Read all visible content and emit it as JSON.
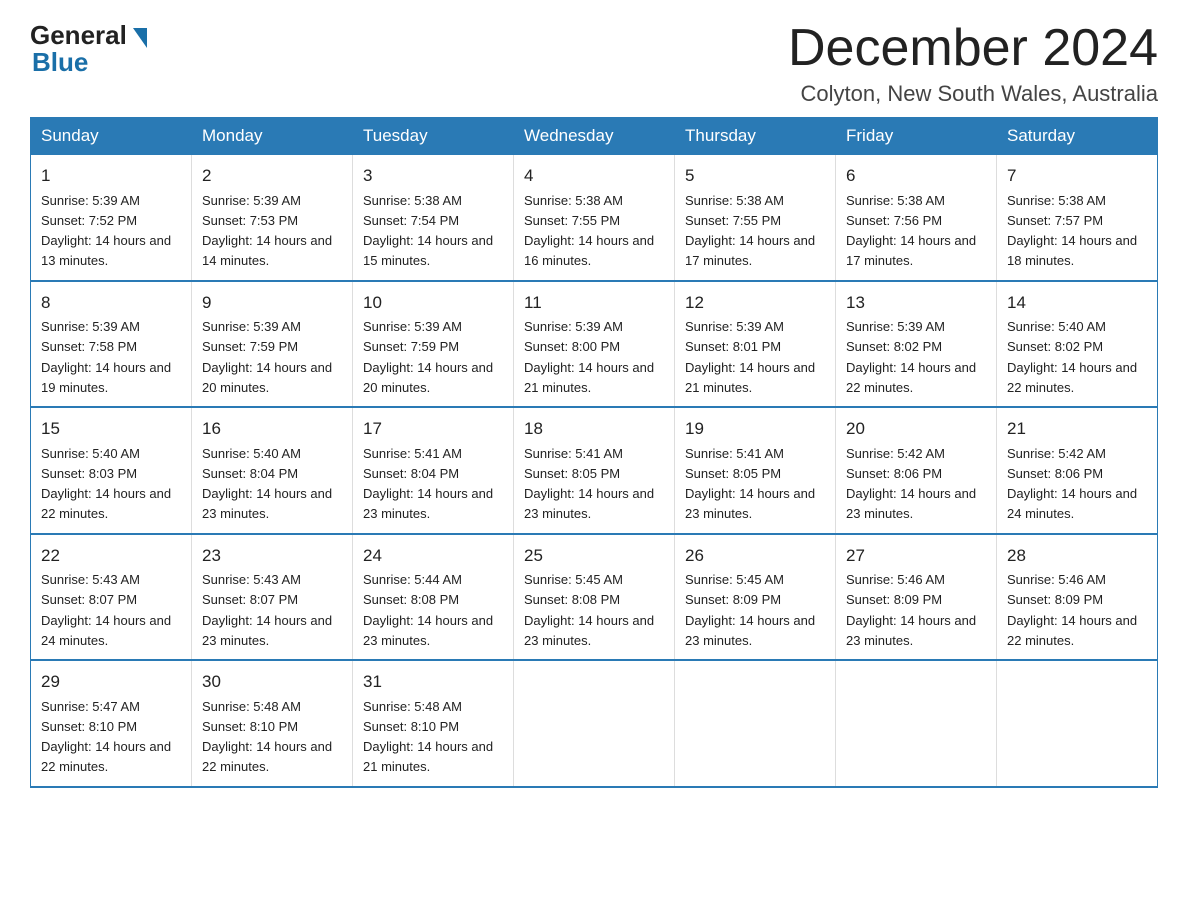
{
  "header": {
    "logo_general": "General",
    "logo_blue": "Blue",
    "month_title": "December 2024",
    "location": "Colyton, New South Wales, Australia"
  },
  "days_header": [
    "Sunday",
    "Monday",
    "Tuesday",
    "Wednesday",
    "Thursday",
    "Friday",
    "Saturday"
  ],
  "weeks": [
    [
      {
        "day": "1",
        "sunrise": "5:39 AM",
        "sunset": "7:52 PM",
        "daylight": "14 hours and 13 minutes."
      },
      {
        "day": "2",
        "sunrise": "5:39 AM",
        "sunset": "7:53 PM",
        "daylight": "14 hours and 14 minutes."
      },
      {
        "day": "3",
        "sunrise": "5:38 AM",
        "sunset": "7:54 PM",
        "daylight": "14 hours and 15 minutes."
      },
      {
        "day": "4",
        "sunrise": "5:38 AM",
        "sunset": "7:55 PM",
        "daylight": "14 hours and 16 minutes."
      },
      {
        "day": "5",
        "sunrise": "5:38 AM",
        "sunset": "7:55 PM",
        "daylight": "14 hours and 17 minutes."
      },
      {
        "day": "6",
        "sunrise": "5:38 AM",
        "sunset": "7:56 PM",
        "daylight": "14 hours and 17 minutes."
      },
      {
        "day": "7",
        "sunrise": "5:38 AM",
        "sunset": "7:57 PM",
        "daylight": "14 hours and 18 minutes."
      }
    ],
    [
      {
        "day": "8",
        "sunrise": "5:39 AM",
        "sunset": "7:58 PM",
        "daylight": "14 hours and 19 minutes."
      },
      {
        "day": "9",
        "sunrise": "5:39 AM",
        "sunset": "7:59 PM",
        "daylight": "14 hours and 20 minutes."
      },
      {
        "day": "10",
        "sunrise": "5:39 AM",
        "sunset": "7:59 PM",
        "daylight": "14 hours and 20 minutes."
      },
      {
        "day": "11",
        "sunrise": "5:39 AM",
        "sunset": "8:00 PM",
        "daylight": "14 hours and 21 minutes."
      },
      {
        "day": "12",
        "sunrise": "5:39 AM",
        "sunset": "8:01 PM",
        "daylight": "14 hours and 21 minutes."
      },
      {
        "day": "13",
        "sunrise": "5:39 AM",
        "sunset": "8:02 PM",
        "daylight": "14 hours and 22 minutes."
      },
      {
        "day": "14",
        "sunrise": "5:40 AM",
        "sunset": "8:02 PM",
        "daylight": "14 hours and 22 minutes."
      }
    ],
    [
      {
        "day": "15",
        "sunrise": "5:40 AM",
        "sunset": "8:03 PM",
        "daylight": "14 hours and 22 minutes."
      },
      {
        "day": "16",
        "sunrise": "5:40 AM",
        "sunset": "8:04 PM",
        "daylight": "14 hours and 23 minutes."
      },
      {
        "day": "17",
        "sunrise": "5:41 AM",
        "sunset": "8:04 PM",
        "daylight": "14 hours and 23 minutes."
      },
      {
        "day": "18",
        "sunrise": "5:41 AM",
        "sunset": "8:05 PM",
        "daylight": "14 hours and 23 minutes."
      },
      {
        "day": "19",
        "sunrise": "5:41 AM",
        "sunset": "8:05 PM",
        "daylight": "14 hours and 23 minutes."
      },
      {
        "day": "20",
        "sunrise": "5:42 AM",
        "sunset": "8:06 PM",
        "daylight": "14 hours and 23 minutes."
      },
      {
        "day": "21",
        "sunrise": "5:42 AM",
        "sunset": "8:06 PM",
        "daylight": "14 hours and 24 minutes."
      }
    ],
    [
      {
        "day": "22",
        "sunrise": "5:43 AM",
        "sunset": "8:07 PM",
        "daylight": "14 hours and 24 minutes."
      },
      {
        "day": "23",
        "sunrise": "5:43 AM",
        "sunset": "8:07 PM",
        "daylight": "14 hours and 23 minutes."
      },
      {
        "day": "24",
        "sunrise": "5:44 AM",
        "sunset": "8:08 PM",
        "daylight": "14 hours and 23 minutes."
      },
      {
        "day": "25",
        "sunrise": "5:45 AM",
        "sunset": "8:08 PM",
        "daylight": "14 hours and 23 minutes."
      },
      {
        "day": "26",
        "sunrise": "5:45 AM",
        "sunset": "8:09 PM",
        "daylight": "14 hours and 23 minutes."
      },
      {
        "day": "27",
        "sunrise": "5:46 AM",
        "sunset": "8:09 PM",
        "daylight": "14 hours and 23 minutes."
      },
      {
        "day": "28",
        "sunrise": "5:46 AM",
        "sunset": "8:09 PM",
        "daylight": "14 hours and 22 minutes."
      }
    ],
    [
      {
        "day": "29",
        "sunrise": "5:47 AM",
        "sunset": "8:10 PM",
        "daylight": "14 hours and 22 minutes."
      },
      {
        "day": "30",
        "sunrise": "5:48 AM",
        "sunset": "8:10 PM",
        "daylight": "14 hours and 22 minutes."
      },
      {
        "day": "31",
        "sunrise": "5:48 AM",
        "sunset": "8:10 PM",
        "daylight": "14 hours and 21 minutes."
      },
      null,
      null,
      null,
      null
    ]
  ]
}
